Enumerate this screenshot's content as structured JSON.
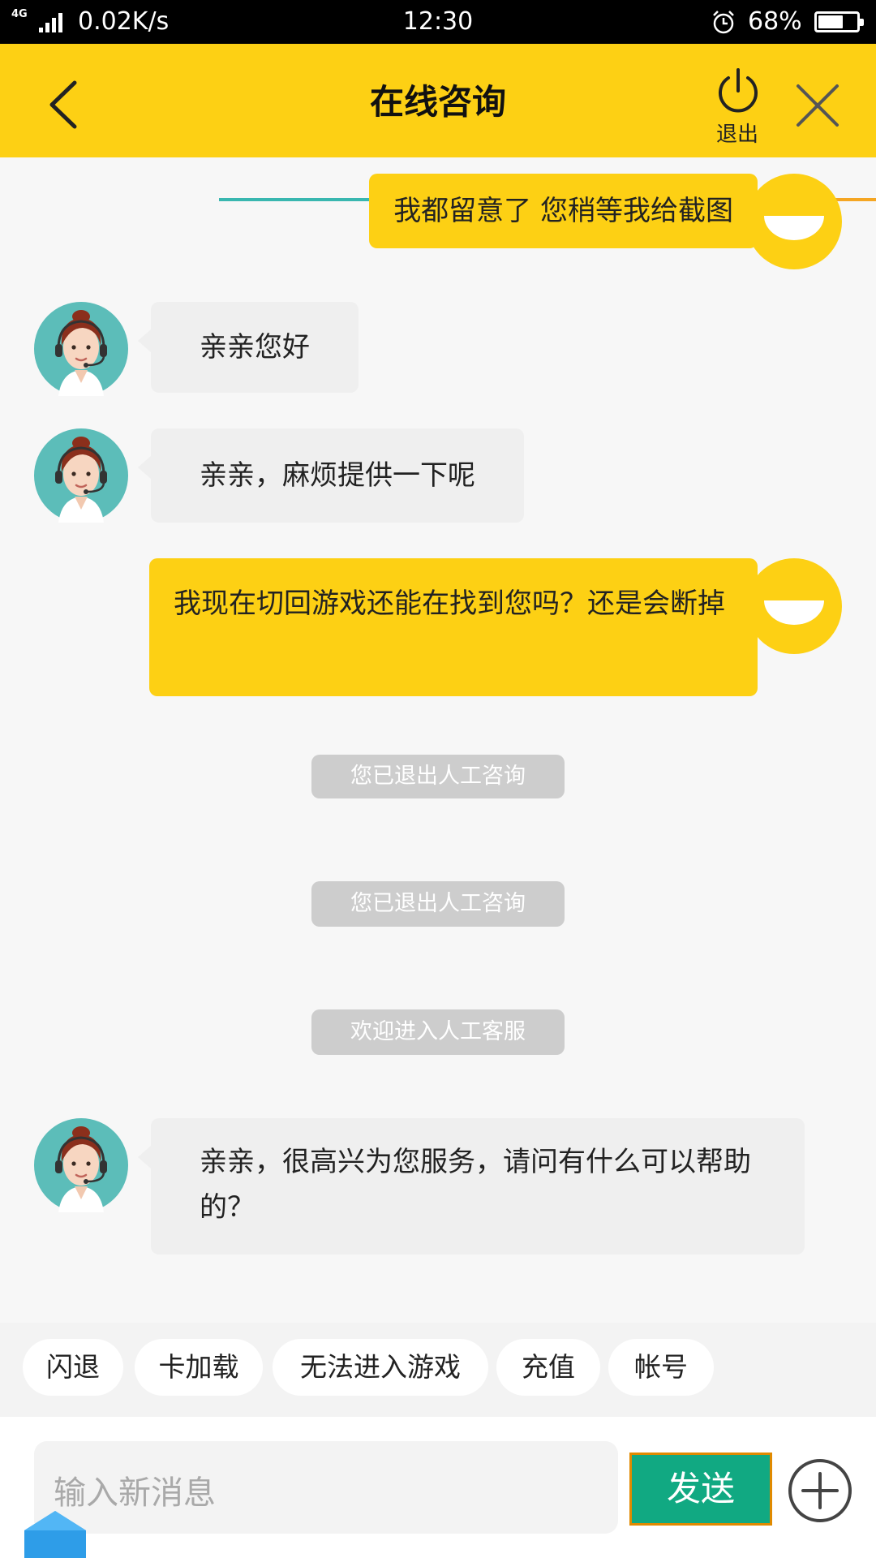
{
  "status_bar": {
    "network": "4G",
    "speed": "0.02K/s",
    "time": "12:30",
    "battery_percent": "68%",
    "battery_level": 0.68
  },
  "header": {
    "title": "在线咨询",
    "exit_label": "退出",
    "colors": {
      "background": "#fdd014"
    }
  },
  "messages": [
    {
      "side": "right",
      "text": "我都留意了  您稍等我给截图"
    },
    {
      "side": "left",
      "text": "亲亲您好"
    },
    {
      "side": "left",
      "text": "亲亲，麻烦提供一下呢"
    },
    {
      "side": "right",
      "text": "我现在切回游戏还能在找到您吗？还是会断掉"
    },
    {
      "side": "system",
      "text": "您已退出人工咨询"
    },
    {
      "side": "system",
      "text": "您已退出人工咨询"
    },
    {
      "side": "system",
      "text": "欢迎进入人工客服"
    },
    {
      "side": "left",
      "text": "亲亲，很高兴为您服务，请问有什么可以帮助的？"
    }
  ],
  "quick_replies": [
    "闪退",
    "卡加载",
    "无法进入游戏",
    "充值",
    "帐号"
  ],
  "input": {
    "placeholder": "输入新消息",
    "value": "",
    "send_label": "发送"
  },
  "icons": {
    "back": "back-arrow-icon",
    "exit": "power-icon",
    "close": "close-icon",
    "plus": "plus-circle-icon",
    "user_avatar": "smiley-avatar",
    "agent_avatar": "agent-headset-avatar"
  },
  "colors": {
    "accent_yellow": "#fdd014",
    "send_green": "#11a982",
    "send_border": "#e08a00",
    "system_pill": "#cdcdcd"
  }
}
